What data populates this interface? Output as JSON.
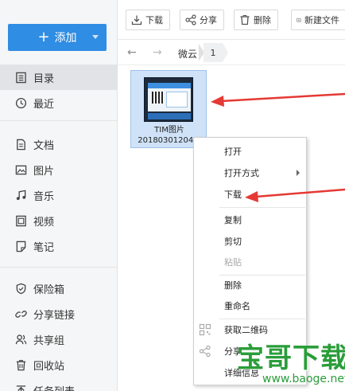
{
  "sidebar": {
    "add_label": "添加",
    "items": [
      {
        "label": "目录",
        "icon": "list-icon"
      },
      {
        "label": "最近",
        "icon": "clock-icon"
      },
      {
        "label": "文档",
        "icon": "document-icon"
      },
      {
        "label": "图片",
        "icon": "image-icon"
      },
      {
        "label": "音乐",
        "icon": "music-icon"
      },
      {
        "label": "视频",
        "icon": "video-icon"
      },
      {
        "label": "笔记",
        "icon": "note-icon"
      },
      {
        "label": "保险箱",
        "icon": "shield-icon"
      },
      {
        "label": "分享链接",
        "icon": "link-icon"
      },
      {
        "label": "共享组",
        "icon": "group-icon"
      },
      {
        "label": "回收站",
        "icon": "trash-icon"
      },
      {
        "label": "任务列表",
        "icon": "task-icon"
      }
    ]
  },
  "toolbar": {
    "download": "下载",
    "share": "分享",
    "delete": "删除",
    "new_folder": "新建文件"
  },
  "breadcrumb": {
    "root": "微云",
    "current": "1"
  },
  "file": {
    "name_line1": "TIM图片",
    "name_line2": "20180301204..."
  },
  "context_menu": {
    "open": "打开",
    "open_with": "打开方式",
    "download": "下载",
    "copy": "复制",
    "cut": "剪切",
    "paste": "粘贴",
    "delete": "删除",
    "rename": "重命名",
    "qrcode": "获取二维码",
    "share": "分享",
    "details": "详细信息"
  },
  "watermark": {
    "text": "宝哥下载",
    "url": "www.baoge.net"
  },
  "colors": {
    "accent": "#2f8de4",
    "selected_tile": "#cfe2f7",
    "annotation": "#e53935",
    "watermark": "#2a9d3a"
  }
}
